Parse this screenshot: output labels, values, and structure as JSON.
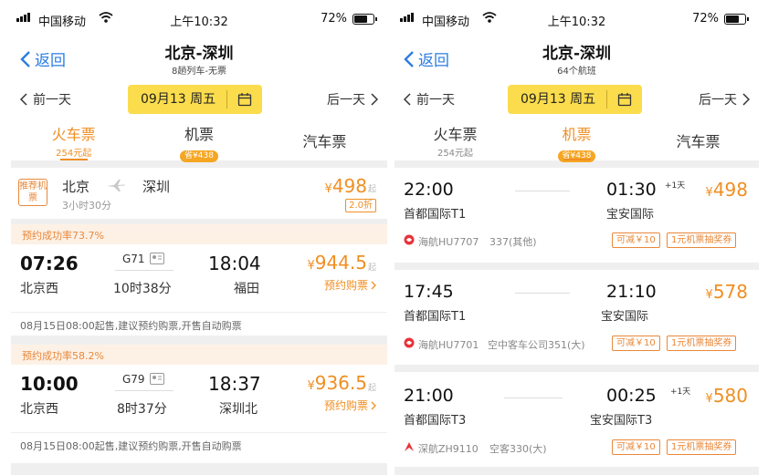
{
  "status": {
    "carrier": "中国移动",
    "time": "上午10:32",
    "battery": "72%"
  },
  "left": {
    "back": "返回",
    "title": "北京-深圳",
    "subtitle": "8趟列车-无票",
    "prev": "前一天",
    "next": "后一天",
    "date": "09月13 周五",
    "tabs": [
      {
        "label": "火车票",
        "sub": "254元起"
      },
      {
        "label": "机票",
        "badge": "省¥438"
      },
      {
        "label": "汽车票"
      }
    ],
    "recommend": {
      "badge": "推荐机票",
      "from": "北京",
      "to": "深圳",
      "duration": "3小时30分",
      "price_symbol": "¥",
      "price": "498",
      "suffix": "起",
      "discount": "2.0折"
    },
    "trains": [
      {
        "rate": "预约成功率73.7%",
        "depart": "07:26",
        "train_no": "G71",
        "arrive": "18:04",
        "from": "北京西",
        "duration": "10时38分",
        "to": "福田",
        "price_symbol": "¥",
        "price": "944.5",
        "suffix": "起",
        "action": "预约购票",
        "note": "08月15日08:00起售,建议预约购票,开售自动购票"
      },
      {
        "rate": "预约成功率58.2%",
        "depart": "10:00",
        "train_no": "G79",
        "arrive": "18:37",
        "from": "北京西",
        "duration": "8时37分",
        "to": "深圳北",
        "price_symbol": "¥",
        "price": "936.5",
        "suffix": "起",
        "action": "预约购票",
        "note": "08月15日08:00起售,建议预约购票,开售自动购票"
      }
    ]
  },
  "right": {
    "back": "返回",
    "title": "北京-深圳",
    "subtitle": "64个航班",
    "prev": "前一天",
    "next": "后一天",
    "date": "09月13 周五",
    "tabs": [
      {
        "label": "火车票",
        "sub": "254元起"
      },
      {
        "label": "机票",
        "badge": "省¥438"
      },
      {
        "label": "汽车票"
      }
    ],
    "flights": [
      {
        "depart": "22:00",
        "arrive": "01:30",
        "plus": "+1天",
        "from": "首都国际T1",
        "to": "宝安国际",
        "price_symbol": "¥",
        "price": "498",
        "airline": "海航HU7707",
        "aircraft": "337(其他)",
        "tag1": "可减￥10",
        "tag2": "1元机票抽奖券"
      },
      {
        "depart": "17:45",
        "arrive": "21:10",
        "plus": "",
        "from": "首都国际T1",
        "to": "宝安国际",
        "price_symbol": "¥",
        "price": "578",
        "airline": "海航HU7701",
        "aircraft": "空中客车公司351(大)",
        "tag1": "可减￥10",
        "tag2": "1元机票抽奖券"
      },
      {
        "depart": "21:00",
        "arrive": "00:25",
        "plus": "+1天",
        "from": "首都国际T3",
        "to": "宝安国际T3",
        "price_symbol": "¥",
        "price": "580",
        "airline": "深航ZH9110",
        "aircraft": "空客330(大)",
        "tag1": "可减￥10",
        "tag2": "1元机票抽奖券"
      }
    ]
  },
  "colors": {
    "accent": "#f08f23",
    "back_blue": "#2b7de0",
    "date_yellow": "#fbdc4c"
  }
}
